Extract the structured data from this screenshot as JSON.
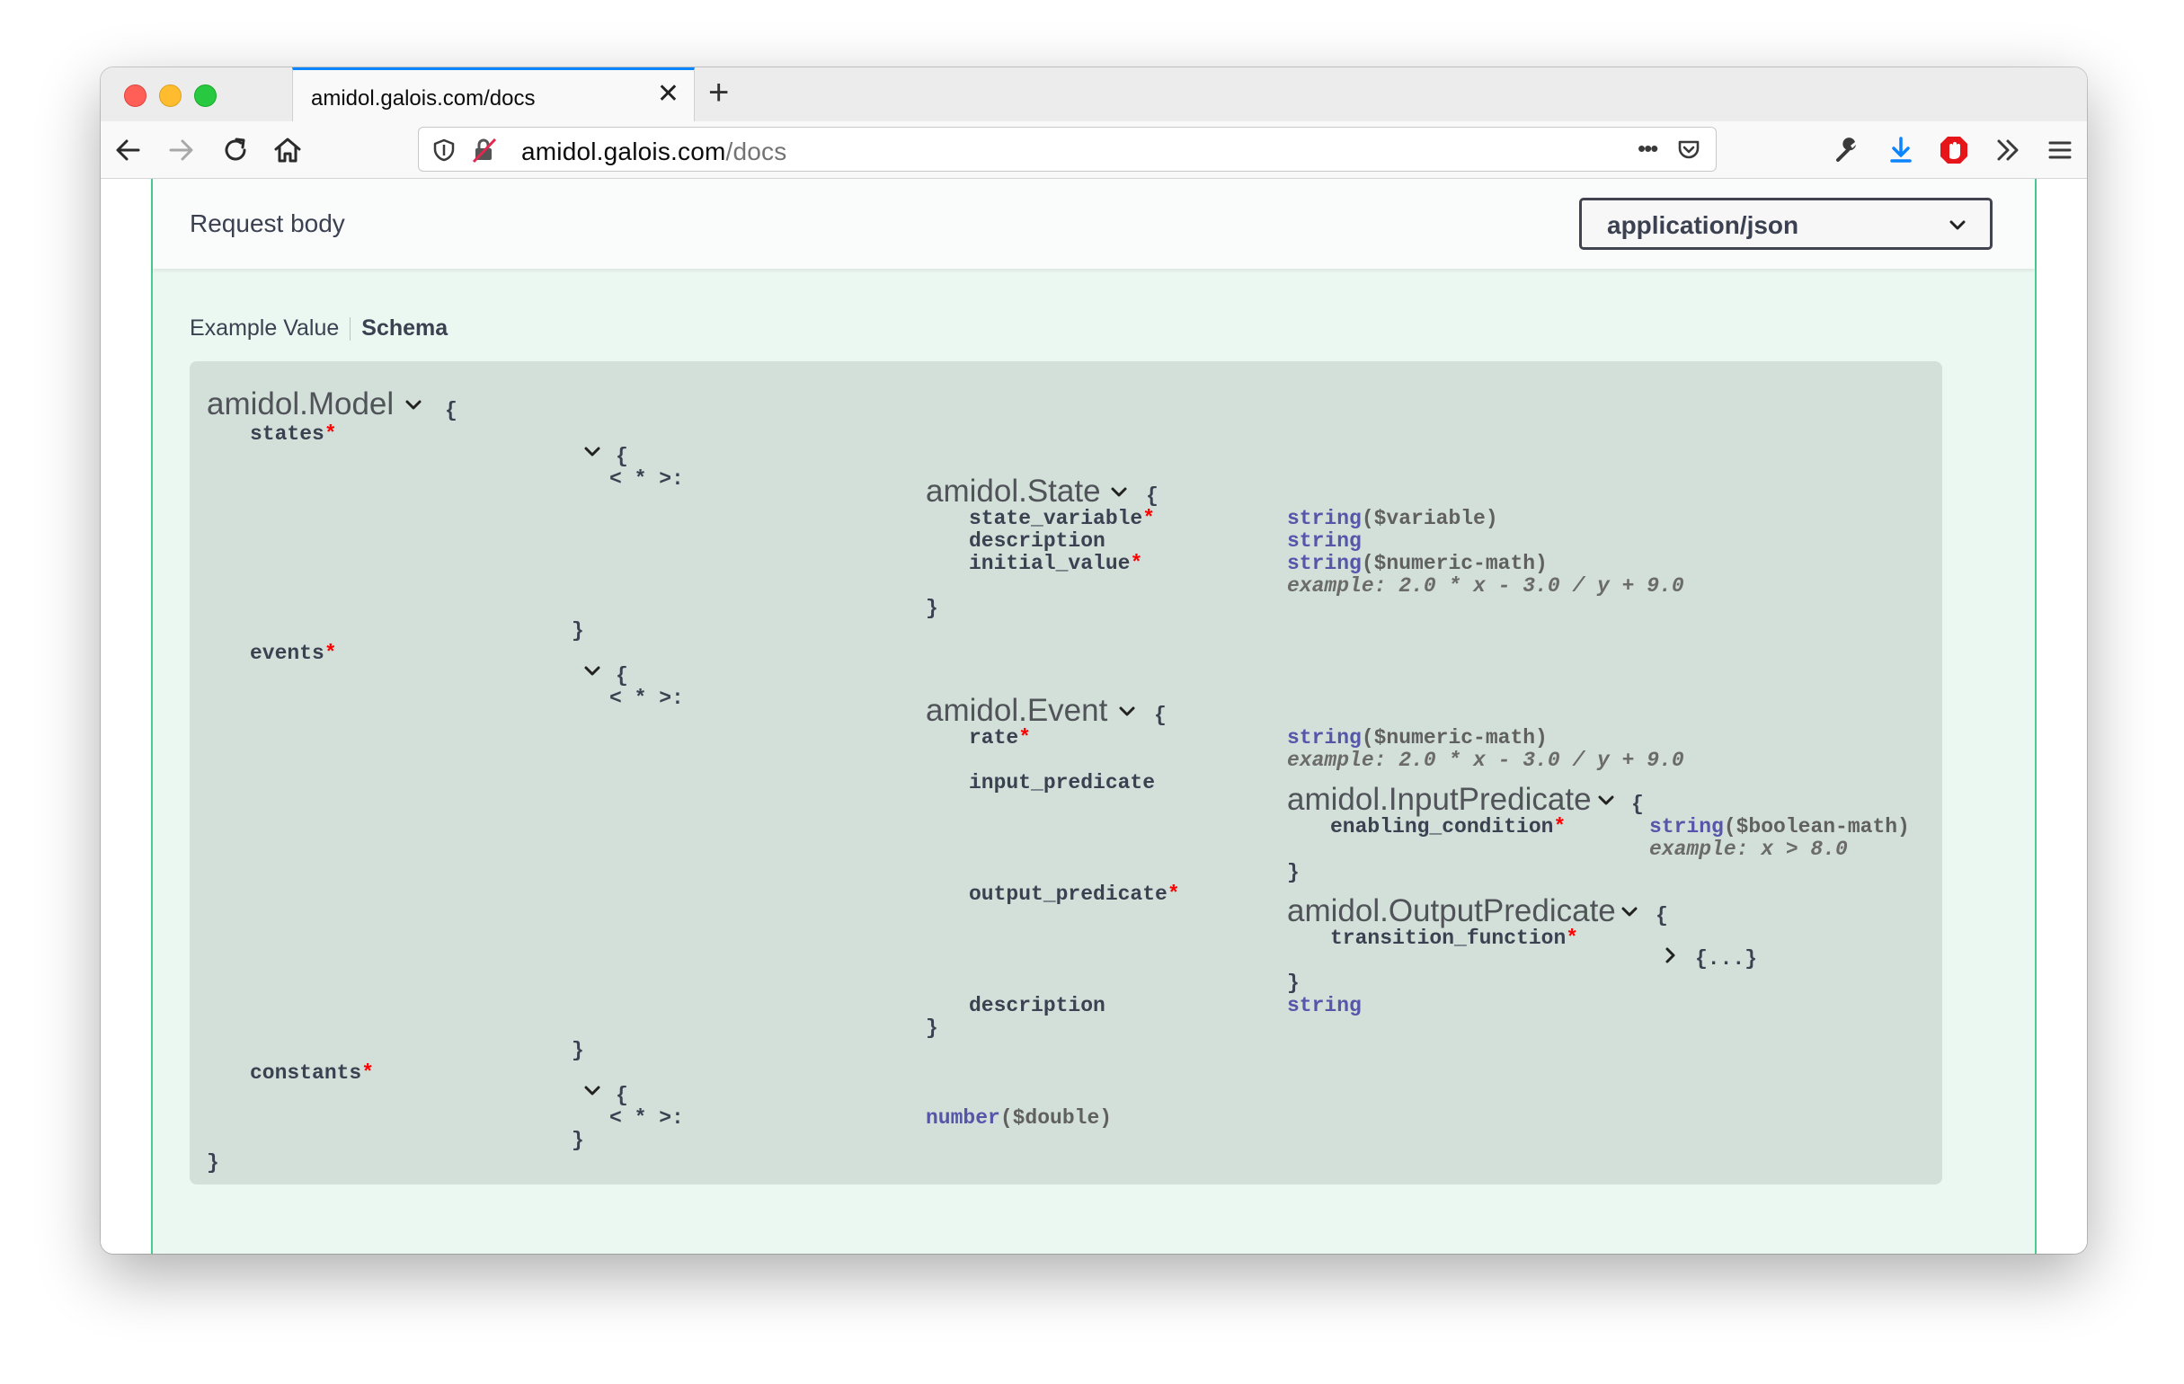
{
  "browser": {
    "tab_title": "amidol.galois.com/docs",
    "tab_close": "✕",
    "new_tab": "+",
    "url_host": "amidol.galois.com",
    "url_path": "/docs",
    "url_more": "•••"
  },
  "request_body": {
    "title": "Request body",
    "content_type": "application/json",
    "tabs": [
      "Example Value",
      "Schema"
    ],
    "active_tab": "Schema"
  },
  "schema": {
    "model_title": "amidol.Model",
    "open_brace": "{",
    "close_brace": "}",
    "map_key": "< * >:",
    "collapsed": "{...}",
    "required_mark": "*",
    "states_label": "states",
    "events_label": "events",
    "constants_label": "constants",
    "state": {
      "title": "amidol.State",
      "props": [
        {
          "name": "state_variable",
          "required": true,
          "type": "string",
          "format": "($variable)"
        },
        {
          "name": "description",
          "required": false,
          "type": "string",
          "format": ""
        },
        {
          "name": "initial_value",
          "required": true,
          "type": "string",
          "format": "($numeric-math)",
          "example": "example: 2.0 * x - 3.0 / y + 9.0"
        }
      ]
    },
    "event": {
      "title": "amidol.Event",
      "rate_name": "rate",
      "rate_type": "string",
      "rate_format": "($numeric-math)",
      "rate_example": "example: 2.0 * x - 3.0 / y + 9.0",
      "input_predicate_name": "input_predicate",
      "input_predicate_title": "amidol.InputPredicate",
      "enabling_condition_name": "enabling_condition",
      "enabling_condition_type": "string",
      "enabling_condition_format": "($boolean-math)",
      "enabling_condition_example": "example: x > 8.0",
      "output_predicate_name": "output_predicate",
      "output_predicate_title": "amidol.OutputPredicate",
      "transition_function_name": "transition_function",
      "description_name": "description",
      "description_type": "string"
    },
    "constant_type": "number",
    "constant_format": "($double)"
  },
  "colors": {
    "section_border": "#49cc90",
    "section_bg": "#ebf7f1",
    "model_bg": "#d3e0da",
    "type_color": "#5555aa",
    "required_color": "#ff0000"
  }
}
